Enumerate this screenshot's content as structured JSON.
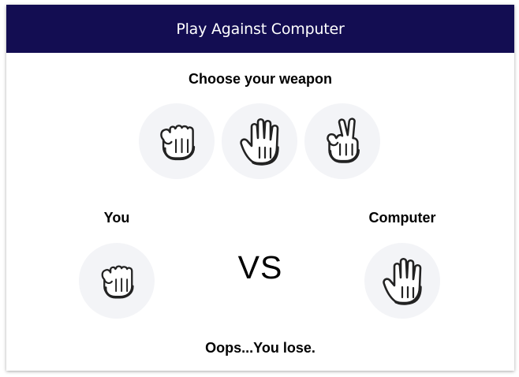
{
  "header": {
    "title": "Play Against Computer"
  },
  "prompt": "Choose your weapon",
  "weapons": [
    {
      "id": "rock",
      "icon": "rock-hand-icon"
    },
    {
      "id": "paper",
      "icon": "paper-hand-icon"
    },
    {
      "id": "scissors",
      "icon": "scissors-hand-icon"
    }
  ],
  "arena": {
    "you_label": "You",
    "computer_label": "Computer",
    "vs_text": "VS",
    "you_choice_icon": "rock-hand-icon",
    "computer_choice_icon": "paper-hand-icon"
  },
  "result_text": "Oops...You lose.",
  "colors": {
    "header_bg": "#130d52",
    "header_text": "#ffffff",
    "circle_bg": "#f3f4f7"
  }
}
